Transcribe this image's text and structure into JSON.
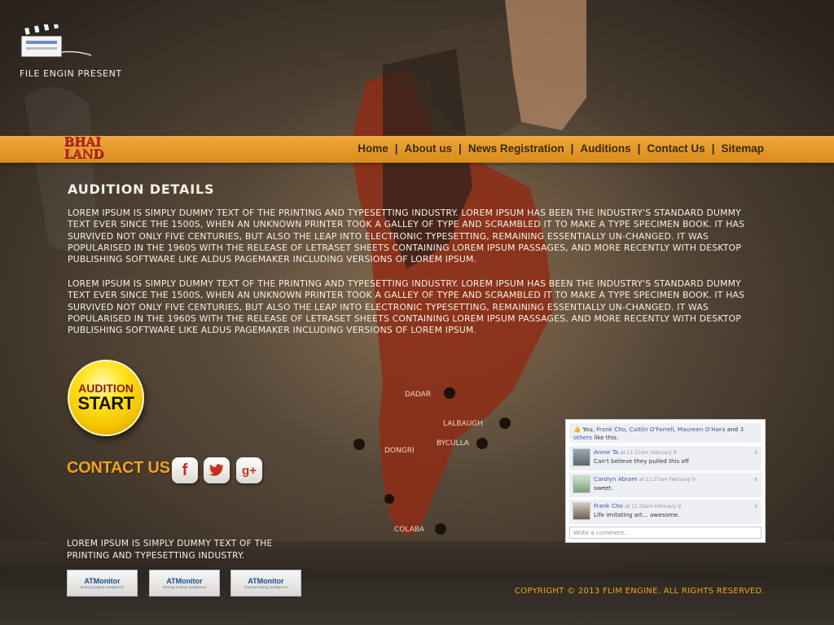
{
  "header": {
    "presents": "FILE ENGIN PRESENT",
    "brand_line1": "BHAI",
    "brand_line2": "LAND"
  },
  "nav": {
    "items": [
      "Home",
      "About us",
      "News Registration",
      "Auditions",
      "Contact Us",
      "Sitemap"
    ],
    "separator": "|"
  },
  "content": {
    "title": "AUDITION DETAILS",
    "paragraphs": [
      "Lorem Ipsum is simply dummy text of the printing and typesetting industry. Lorem Ipsum has been the industry's standard dummy text ever since the 1500s, when an unknown printer took a galley of type and scrambled it to make a type specimen book. It has survived not only five centuries, but also the leap into electronic typesetting, remaining essentially un-changed. It was popularised in the 1960s with the release of Letraset sheets containing Lorem Ipsum passages, and more recently with desktop publishing software like Aldus PageMaker including versions of Lorem Ipsum.",
      "Lorem Ipsum is simply dummy text of the printing and typesetting industry. Lorem Ipsum has been the industry's standard dummy text ever since the 1500s, when an unknown printer took a galley of type and scrambled it to make a type specimen book. It has survived not only five centuries, but also the leap into electronic typesetting, remaining essentially un-changed. It was popularised in the 1960s with the release of Letraset sheets containing Lorem Ipsum passages, and more recently with desktop publishing software like Aldus PageMaker including versions of Lorem Ipsum."
    ]
  },
  "audition_button": {
    "line1": "AUDITION",
    "line2": "START"
  },
  "contact": {
    "title": "CONTACT US",
    "social": [
      "facebook-icon",
      "twitter-icon",
      "google-plus-icon"
    ],
    "facebook_glyph": "f",
    "gplus_glyph": "g+"
  },
  "map_labels": [
    "DADAR",
    "LALBAUGH",
    "BYCULLA",
    "DONGRI",
    "COLABA"
  ],
  "fb_widget": {
    "likes_you": "You,",
    "likes_names": "Frank Cho, Caitlin O'Farrell, Maureen O'Hara",
    "likes_and": "and",
    "likes_others": "3 others",
    "likes_suffix": "like this.",
    "comments": [
      {
        "name": "Annie Ta",
        "time": "at 11:27am February 9",
        "text": "Can't believe they pulled this off"
      },
      {
        "name": "Carolyn Abram",
        "time": "at 11:27am February 9",
        "text": "sweet."
      },
      {
        "name": "Frank Cho",
        "time": "at 11:30am February 9",
        "text": "Life imitating art... awesome."
      }
    ],
    "close_glyph": "x",
    "input_placeholder": "Write a comment..."
  },
  "footer": {
    "text": "Lorem Ipsum is simply dummy text of the printing and typesetting industry.",
    "partners": [
      {
        "name": "ATMonitor",
        "tagline": "sharing trading intelligence"
      },
      {
        "name": "ATMonitor",
        "tagline": "sharing trading intelligence"
      },
      {
        "name": "ATMonitor",
        "tagline": "sharing trading intelligence"
      }
    ],
    "copyright": "COPYRIGHT © 2013 FLIM ENGINE. ALL RIGHTS RESERVED."
  },
  "colors": {
    "nav_bar": "#e89a28",
    "accent_orange": "#f0a21e",
    "brand_red": "#d62a17",
    "button_yellow": "#ffe21a"
  }
}
